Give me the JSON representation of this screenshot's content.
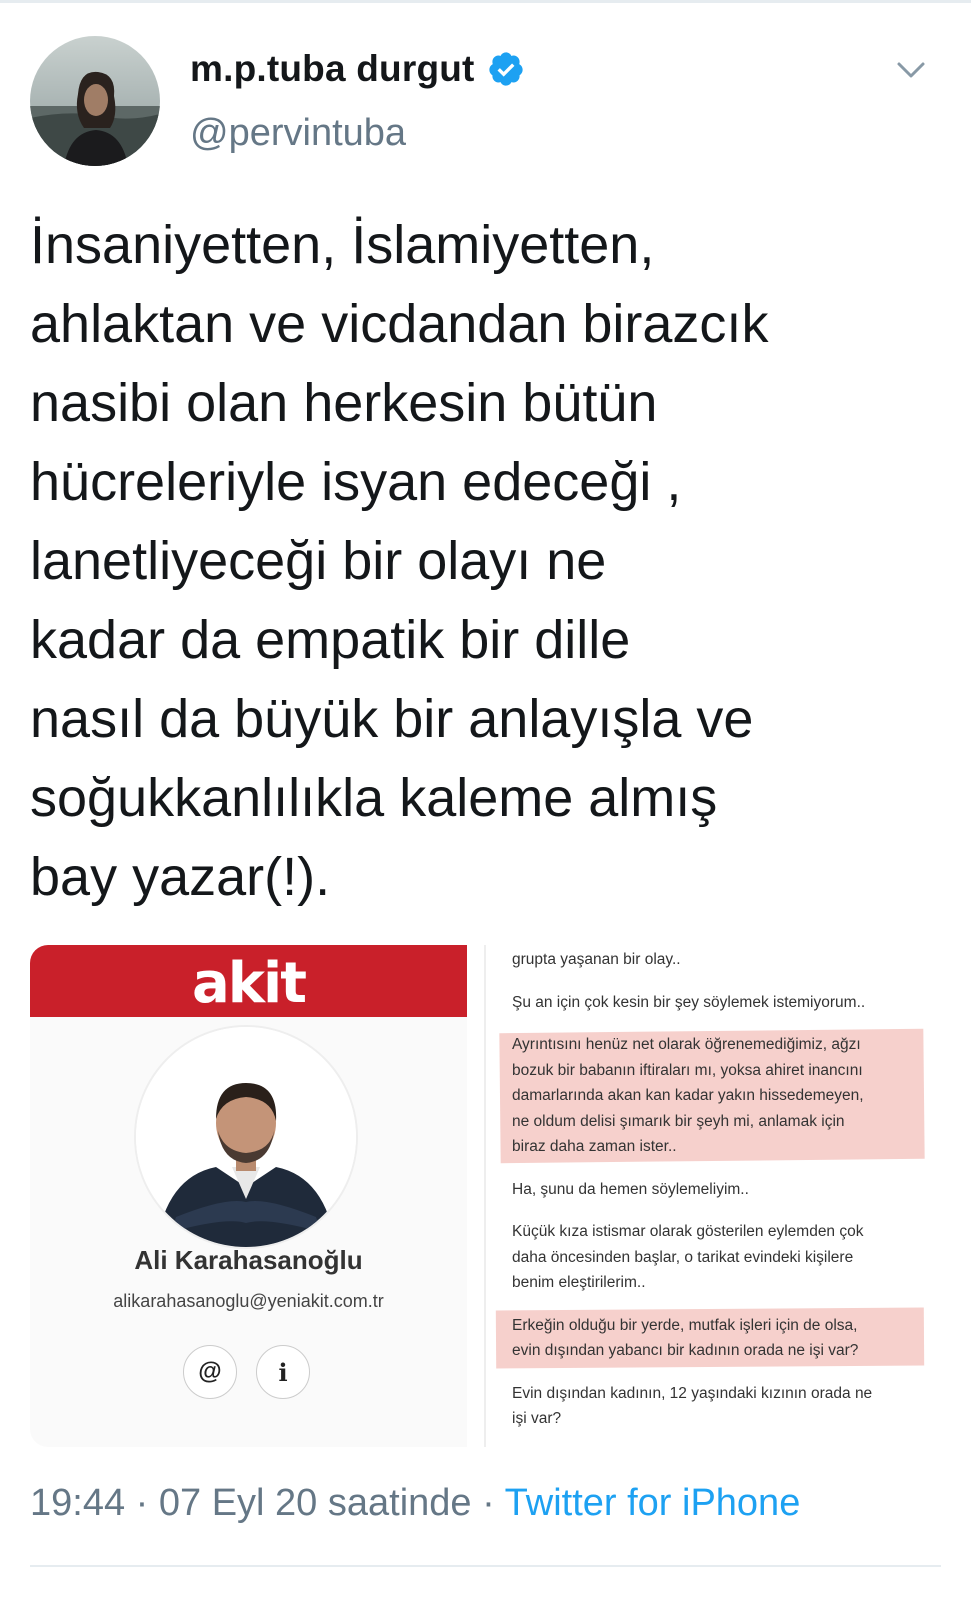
{
  "tweet": {
    "display_name": "m.p.tuba durgut",
    "handle": "@pervintuba",
    "verified_icon": "verified-badge-icon",
    "more_icon": "chevron-down-icon",
    "text_lines": [
      "İnsaniyetten, İslamiyetten,",
      "ahlaktan ve vicdandan birazcık",
      "nasibi olan herkesin bütün",
      "hücreleriyle isyan edeceği ,",
      "lanetliyeceği bir olayı ne",
      "kadar da empatik bir dille",
      "nasıl da büyük bir anlayışla ve",
      "soğukkanlılıkla kaleme almış",
      "bay yazar(!)."
    ],
    "time": "19:44",
    "date": "07 Eyl 20 saatinde",
    "separator": "·",
    "source": "Twitter for iPhone"
  },
  "media": {
    "brand": "akit",
    "author_name": "Ali Karahasanoğlu",
    "author_email": "alikarahasanoglu@yeniakit.com.tr",
    "email_button_icon": "@",
    "info_button_icon": "i",
    "article_lines": [
      "grupta yaşanan bir olay..",
      "",
      "Şu an için çok kesin bir şey söylemek istemiyorum..",
      "",
      "Ayrıntısını henüz net olarak öğrenemediğimiz, ağzı",
      "bozuk bir babanın iftiraları mı, yoksa ahiret inancını",
      "damarlarında akan kan kadar yakın hissedemeyen,",
      "ne oldum delisi şımarık bir şeyh mi, anlamak için",
      "biraz daha zaman ister..",
      "",
      "Ha, şunu da hemen söylemeliyim..",
      "",
      "Küçük kıza istismar olarak gösterilen eylemden çok",
      "daha öncesinden başlar, o tarikat evindeki kişilere",
      "benim eleştirilerim..",
      "",
      "Erkeğin olduğu bir yerde, mutfak işleri için de olsa,",
      "evin dışından yabancı bir kadının orada ne işi var?",
      "",
      "Evin dışından kadının, 12 yaşındaki kızının orada ne",
      "işi var?"
    ]
  },
  "colors": {
    "brand_red": "#c9202a",
    "twitter_blue": "#1da1f2",
    "muted_gray": "#657786",
    "highlight": "#e6786e"
  }
}
